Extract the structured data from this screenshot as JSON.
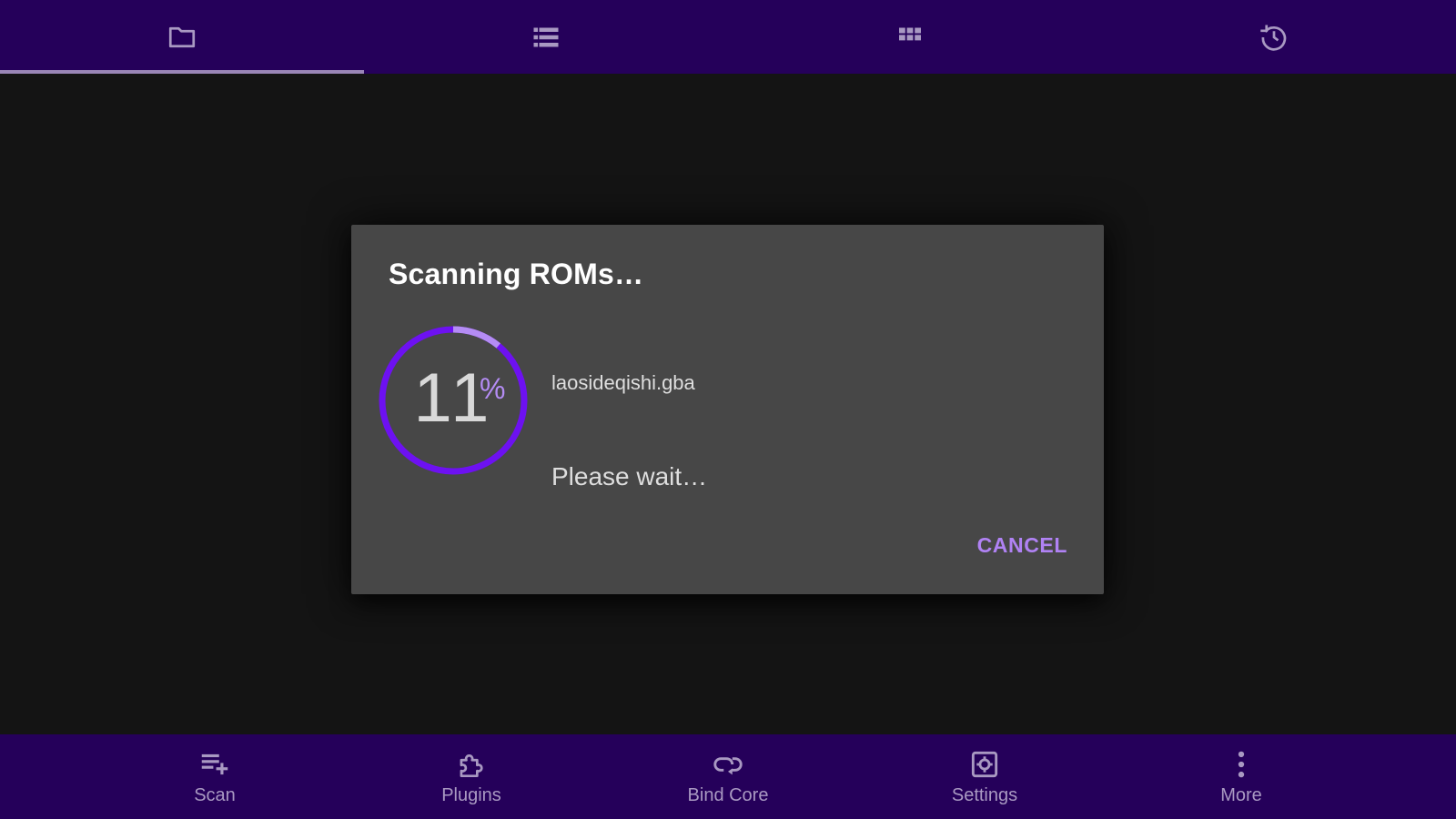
{
  "colors": {
    "app_bar": "#25005a",
    "background": "#141414",
    "dialog": "#474747",
    "accent": "#b082f4",
    "progress_ring": "#6d11f1",
    "progress_ring_fill": "#b48cf4",
    "icon": "#a999c2"
  },
  "top_tabs": [
    {
      "icon": "folder-icon",
      "active": true
    },
    {
      "icon": "list-icon",
      "active": false
    },
    {
      "icon": "grid-icon",
      "active": false
    },
    {
      "icon": "history-icon",
      "active": false
    }
  ],
  "dialog": {
    "title": "Scanning ROMs…",
    "progress": {
      "value": "11",
      "unit": "%",
      "fraction": 0.11
    },
    "file_name": "laosideqishi.gba",
    "message": "Please wait…",
    "cancel_label": "CANCEL"
  },
  "bottom_nav": [
    {
      "label": "Scan",
      "icon": "scan-icon"
    },
    {
      "label": "Plugins",
      "icon": "plugins-icon"
    },
    {
      "label": "Bind Core",
      "icon": "bind-core-icon"
    },
    {
      "label": "Settings",
      "icon": "settings-icon"
    },
    {
      "label": "More",
      "icon": "more-icon"
    }
  ]
}
